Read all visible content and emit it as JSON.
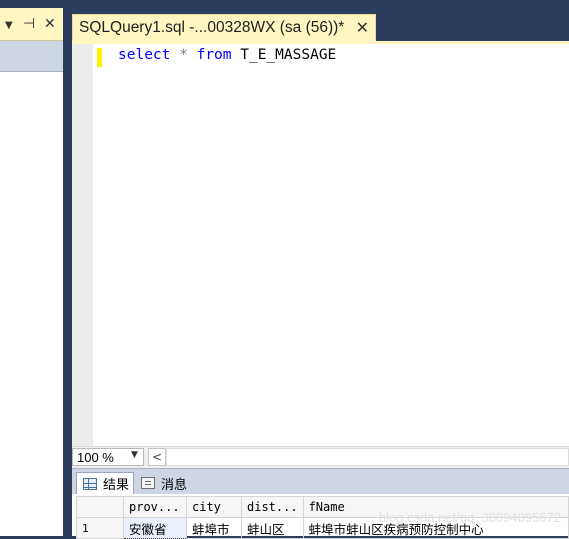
{
  "left_panel": {
    "controls": [
      "▼",
      "⊣",
      "✕"
    ]
  },
  "document_tab": {
    "title": "SQLQuery1.sql -...00328WX (sa (56))*",
    "close": "✕"
  },
  "editor": {
    "tokens": [
      {
        "text": "select",
        "kind": "kw"
      },
      {
        "text": " ",
        "kind": "id"
      },
      {
        "text": "*",
        "kind": "op"
      },
      {
        "text": " ",
        "kind": "id"
      },
      {
        "text": "from",
        "kind": "kw"
      },
      {
        "text": " T_E_MASSAGE",
        "kind": "id"
      }
    ]
  },
  "zoom": {
    "value": "100 %",
    "arrow": "▼",
    "scroll_left": "<"
  },
  "results_tabs": {
    "results": "结果",
    "messages": "消息"
  },
  "grid": {
    "columns": [
      "prov...",
      "city",
      "dist...",
      "fName"
    ],
    "rows": [
      {
        "num": "1",
        "cells": [
          "安徽省",
          "蚌埠市",
          "蚌山区",
          "蚌埠市蚌山区疾病预防控制中心"
        ]
      }
    ],
    "watermark": "blog.csdn.net/qq_38094095672"
  }
}
